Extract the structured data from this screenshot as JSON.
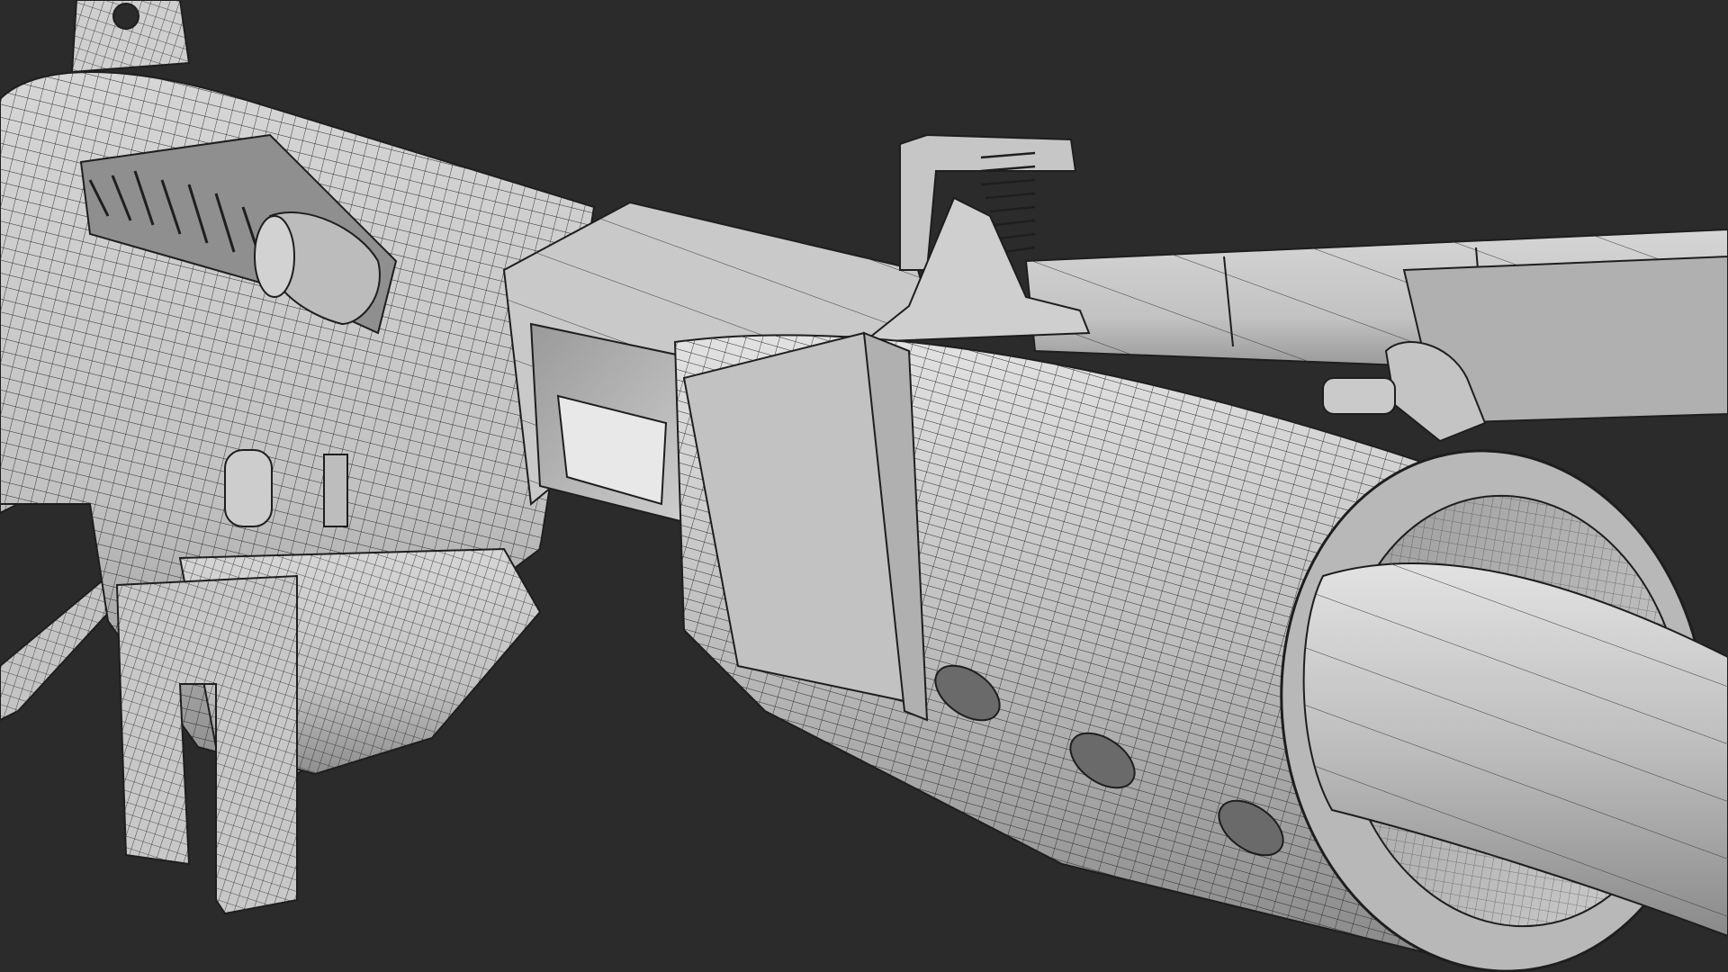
{
  "scene": {
    "background_color": "#2b2b2b",
    "mesh_fill_color": "#c9c9c9",
    "mesh_shadow_color": "#8e8e8e",
    "wire_color": "#1e1e1e",
    "highlight_color": "#e6e6e6",
    "object": "wireframe-weapon-model"
  }
}
